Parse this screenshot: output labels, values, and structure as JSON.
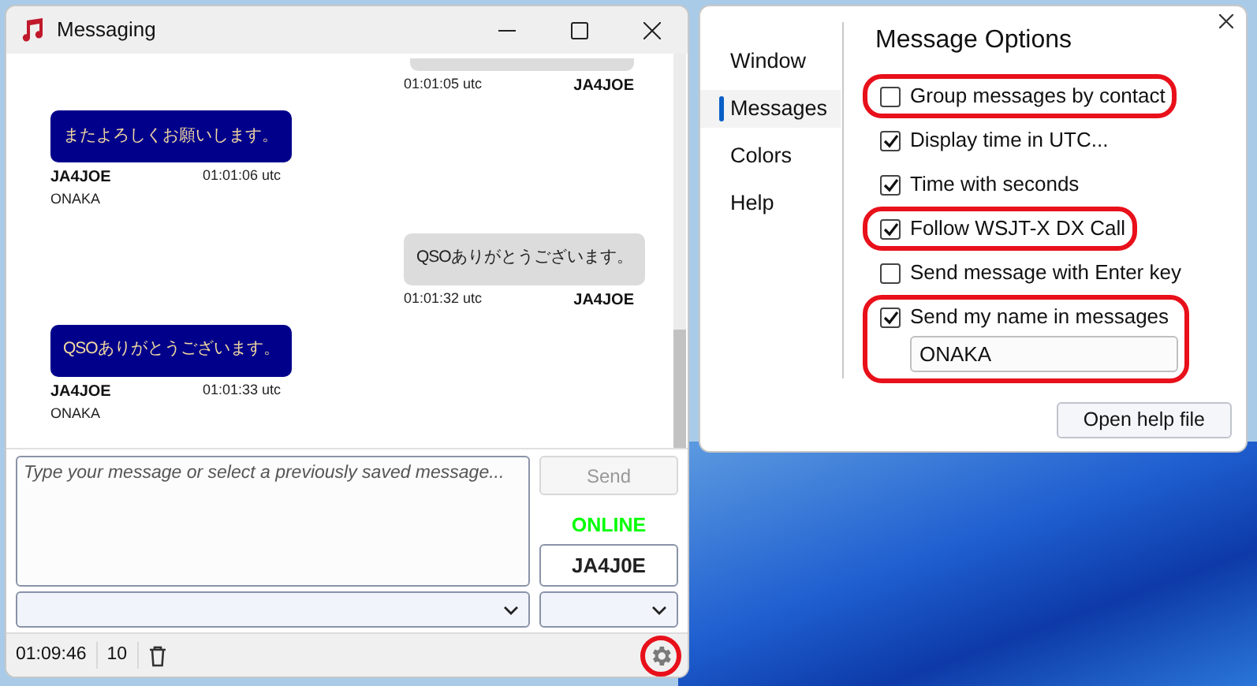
{
  "messaging_window": {
    "title": "Messaging",
    "messages": [
      {
        "kind": "outgoing",
        "time": "01:01:05 utc",
        "callsign": "JA4JOE"
      },
      {
        "kind": "incoming",
        "text": "またよろしくお願いします。",
        "time": "01:01:06 utc",
        "callsign": "JA4JOE",
        "name": "ONAKA"
      },
      {
        "kind": "outgoing",
        "text": "QSOありがとうございます。",
        "time": "01:01:32 utc",
        "callsign": "JA4JOE"
      },
      {
        "kind": "incoming",
        "text": "QSOありがとうございます。",
        "time": "01:01:33 utc",
        "callsign": "JA4JOE",
        "name": "ONAKA"
      }
    ],
    "composer": {
      "placeholder": "Type your message or select a previously saved message..."
    },
    "send_button": {
      "label": "Send",
      "disabled": true
    },
    "status": {
      "label": "ONLINE",
      "color": "#00ff00"
    },
    "callsign": "JA4J0E",
    "status_bar": {
      "time": "01:09:46",
      "count": "10",
      "settings_highlighted": true
    }
  },
  "options_window": {
    "nav": [
      {
        "label": "Window",
        "selected": false
      },
      {
        "label": "Messages",
        "selected": true
      },
      {
        "label": "Colors",
        "selected": false
      },
      {
        "label": "Help",
        "selected": false
      }
    ],
    "title": "Message Options",
    "options": [
      {
        "label": "Group messages by contact",
        "checked": false,
        "highlighted": true
      },
      {
        "label": "Display time in UTC...",
        "checked": true,
        "highlighted": false
      },
      {
        "label": "Time with seconds",
        "checked": true,
        "highlighted": false
      },
      {
        "label": "Follow WSJT-X DX Call",
        "checked": true,
        "highlighted": true
      },
      {
        "label": "Send message with Enter key",
        "checked": false,
        "highlighted": false
      },
      {
        "label": "Send my name in messages",
        "checked": true,
        "highlighted": true,
        "value": "ONAKA"
      }
    ],
    "help_button": "Open help file"
  }
}
